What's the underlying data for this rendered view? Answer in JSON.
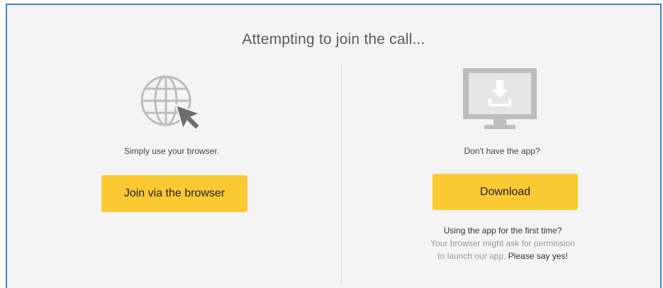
{
  "header": {
    "title": "Attempting to join the call..."
  },
  "browser_option": {
    "icon": "globe-cursor-icon",
    "caption": "Simply use your browser.",
    "button_label": "Join via the browser"
  },
  "app_option": {
    "icon": "monitor-download-icon",
    "caption": "Don't have the app?",
    "button_label": "Download",
    "note": {
      "line1": "Using the app for the first time?",
      "line2": "Your browser might ask for permission",
      "line3_prefix": "to launch our app. ",
      "line3_emphasis": "Please say yes!"
    }
  },
  "colors": {
    "accent_button": "#fbc933",
    "frame_border": "#3b86d0",
    "background": "#f4f4f4"
  }
}
